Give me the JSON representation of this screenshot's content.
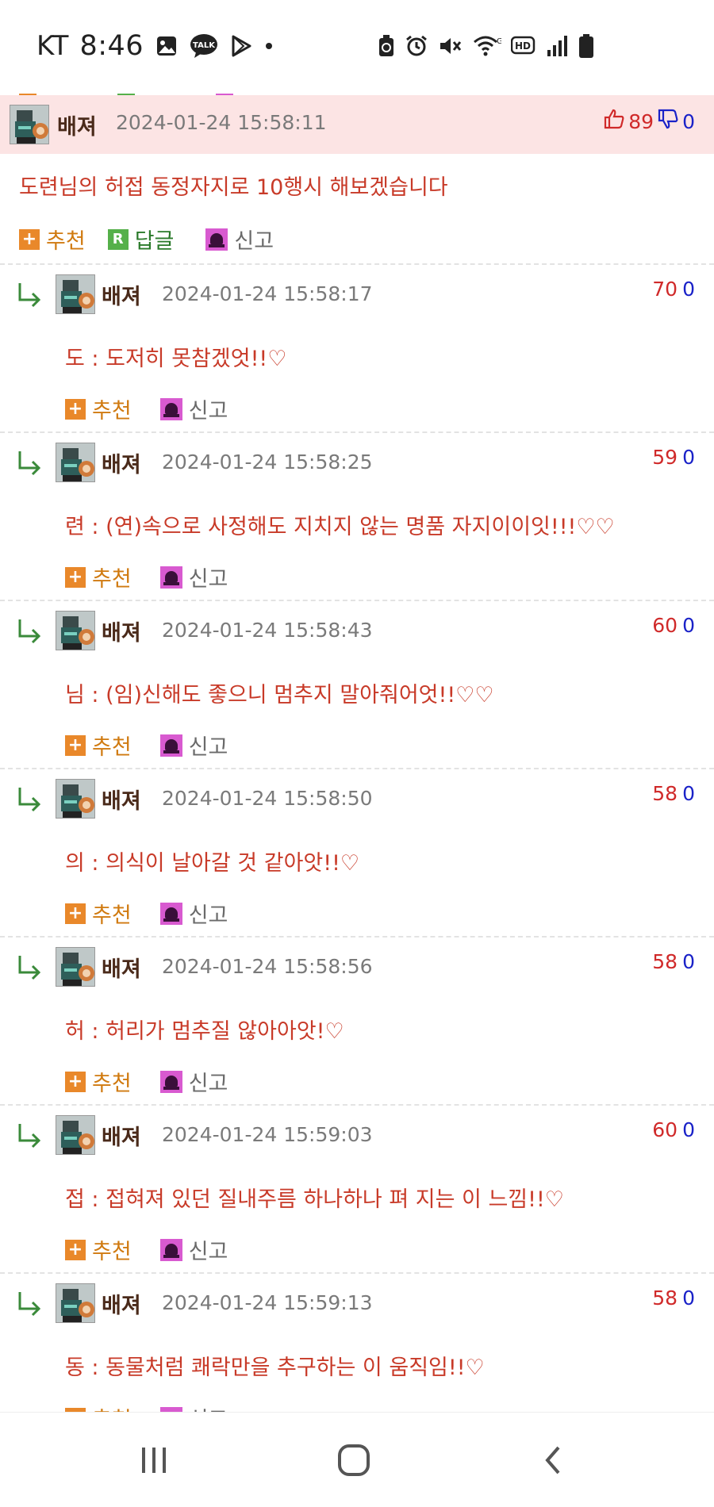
{
  "status_bar": {
    "carrier": "KT",
    "time": "8:46",
    "icons_left": [
      "gallery-icon",
      "talk-icon",
      "play-store-icon",
      "dot-icon"
    ],
    "icons_right": [
      "battery-saver-icon",
      "alarm-icon",
      "mute-icon",
      "wifi-icon",
      "hd-icon",
      "signal-icon",
      "battery-icon"
    ]
  },
  "main_comment": {
    "author": "배져",
    "date": "2024-01-24 15:58:11",
    "likes": "89",
    "dislikes": "0",
    "text": "도련님의 허접 동정자지로 10행시 해보겠습니다",
    "recommend_label": "추천",
    "reply_label": "답글",
    "report_label": "신고"
  },
  "replies": [
    {
      "author": "배져",
      "date": "2024-01-24 15:58:17",
      "likes": "70",
      "dislikes": "0",
      "text": "도 : 도저히 못참겠엇!!♡",
      "recommend_label": "추천",
      "report_label": "신고"
    },
    {
      "author": "배져",
      "date": "2024-01-24 15:58:25",
      "likes": "59",
      "dislikes": "0",
      "text": "련 : (연)속으로 사정해도 지치지 않는 명품 자지이이잇!!!♡♡",
      "recommend_label": "추천",
      "report_label": "신고"
    },
    {
      "author": "배져",
      "date": "2024-01-24 15:58:43",
      "likes": "60",
      "dislikes": "0",
      "text": "님 : (임)신해도 좋으니 멈추지 말아줘어엇!!♡♡",
      "recommend_label": "추천",
      "report_label": "신고"
    },
    {
      "author": "배져",
      "date": "2024-01-24 15:58:50",
      "likes": "58",
      "dislikes": "0",
      "text": "의 : 의식이 날아갈 것 같아앗!!♡",
      "recommend_label": "추천",
      "report_label": "신고"
    },
    {
      "author": "배져",
      "date": "2024-01-24 15:58:56",
      "likes": "58",
      "dislikes": "0",
      "text": "허 : 허리가 멈추질 않아아앗!♡",
      "recommend_label": "추천",
      "report_label": "신고"
    },
    {
      "author": "배져",
      "date": "2024-01-24 15:59:03",
      "likes": "60",
      "dislikes": "0",
      "text": "접 : 접혀져 있던 질내주름 하나하나 펴 지는 이 느낌!!♡",
      "recommend_label": "추천",
      "report_label": "신고"
    },
    {
      "author": "배져",
      "date": "2024-01-24 15:59:13",
      "likes": "58",
      "dislikes": "0",
      "text": "동 : 동물처럼 쾌락만을 추구하는 이 움직임!!♡",
      "recommend_label": "추천",
      "report_label": "신고"
    }
  ],
  "nav_bar": {
    "icons": [
      "recent-apps-icon",
      "home-icon",
      "back-icon"
    ]
  }
}
